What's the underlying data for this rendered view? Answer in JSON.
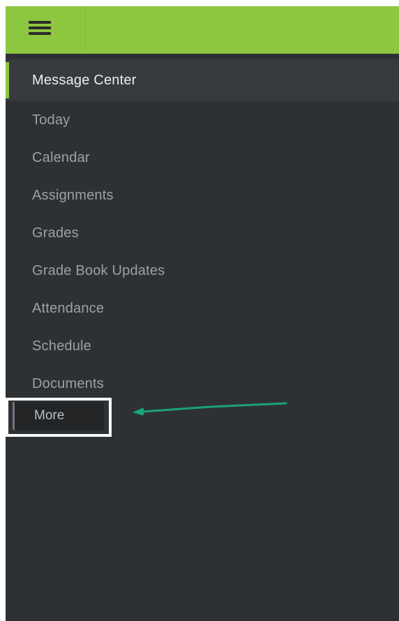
{
  "appbar": {
    "color": "#8dc63f",
    "menu_icon": "hamburger-menu-icon"
  },
  "nav": {
    "items": [
      {
        "label": "Message Center",
        "active": true
      },
      {
        "label": "Today"
      },
      {
        "label": "Calendar"
      },
      {
        "label": "Assignments"
      },
      {
        "label": "Grades"
      },
      {
        "label": "Grade Book Updates"
      },
      {
        "label": "Attendance"
      },
      {
        "label": "Schedule"
      },
      {
        "label": "Documents"
      }
    ],
    "more_label": "More"
  },
  "annotation": {
    "highlight_color": "#ffffff",
    "arrow_color": "#1aa37a"
  }
}
